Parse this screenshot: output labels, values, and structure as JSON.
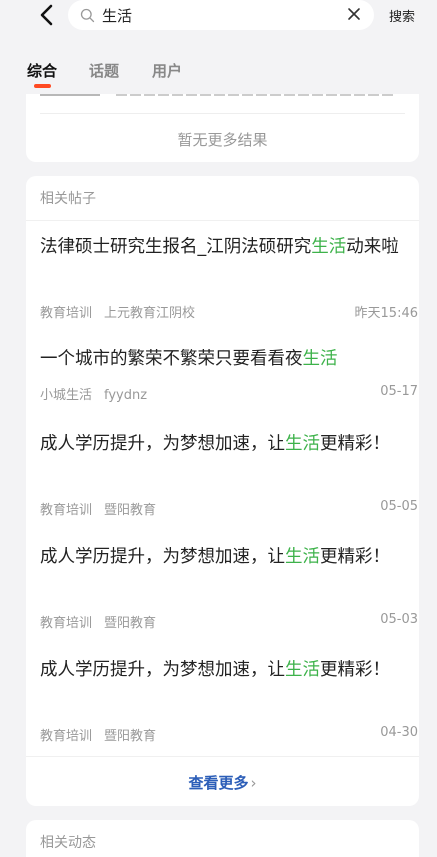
{
  "search": {
    "query": "生活",
    "button_label": "搜索"
  },
  "tabs": [
    {
      "label": "综合",
      "active": true
    },
    {
      "label": "话题",
      "active": false
    },
    {
      "label": "用户",
      "active": false
    }
  ],
  "results_card": {
    "no_more_text": "暂无更多结果"
  },
  "related_posts": {
    "title": "相关帖子",
    "posts": [
      {
        "title_before": "法律硕士研究生报名_江阴法硕研究",
        "highlight": "生活",
        "title_after": "动来啦",
        "category": "教育培训",
        "author": "上元教育江阴校",
        "time": "昨天15:46"
      },
      {
        "title_before": "一个城市的繁荣不繁荣只要看看夜",
        "highlight": "生活",
        "title_after": "",
        "category": "小城生活",
        "author": "fyydnz",
        "time": "05-17"
      },
      {
        "title_before": "成人学历提升，为梦想加速，让",
        "highlight": "生活",
        "title_after": "更精彩！",
        "category": "教育培训",
        "author": "暨阳教育",
        "time": "05-05"
      },
      {
        "title_before": "成人学历提升，为梦想加速，让",
        "highlight": "生活",
        "title_after": "更精彩！",
        "category": "教育培训",
        "author": "暨阳教育",
        "time": "05-03"
      },
      {
        "title_before": "成人学历提升，为梦想加速，让",
        "highlight": "生活",
        "title_after": "更精彩！",
        "category": "教育培训",
        "author": "暨阳教育",
        "time": "04-30"
      }
    ],
    "view_more_label": "查看更多"
  },
  "related_dynamics": {
    "title": "相关动态"
  },
  "colors": {
    "highlight": "#3db24a",
    "accent": "#ff4a22",
    "link": "#2c5eb8"
  },
  "icons": [
    "back-arrow-icon",
    "search-icon",
    "clear-icon",
    "chevron-right-icon"
  ]
}
